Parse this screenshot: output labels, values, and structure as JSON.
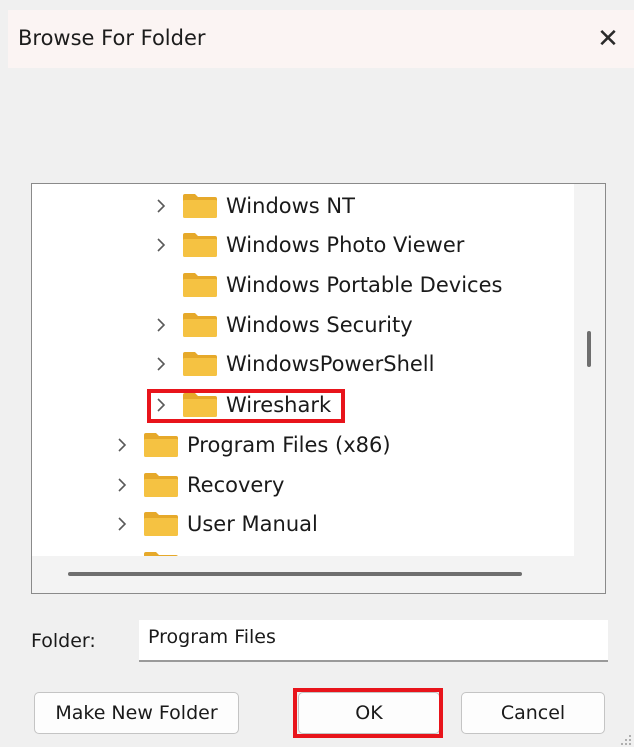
{
  "window": {
    "title": "Browse For Folder",
    "close_glyph": "✕"
  },
  "tree": {
    "items": [
      {
        "label": "Windows NT",
        "expandable": true
      },
      {
        "label": "Windows Photo Viewer",
        "expandable": true
      },
      {
        "label": "Windows Portable Devices",
        "expandable": false
      },
      {
        "label": "Windows Security",
        "expandable": true
      },
      {
        "label": "WindowsPowerShell",
        "expandable": true
      },
      {
        "label": "Wireshark",
        "expandable": true,
        "highlighted": true
      },
      {
        "label": "Program Files (x86)",
        "expandable": true
      },
      {
        "label": "Recovery",
        "expandable": true
      },
      {
        "label": "User Manual",
        "expandable": true
      }
    ]
  },
  "folder": {
    "label": "Folder:",
    "value": "Program Files"
  },
  "buttons": {
    "make_new_folder": "Make New Folder",
    "ok": "OK",
    "cancel": "Cancel"
  },
  "colors": {
    "highlight": "#e8141b",
    "folder_yellow": "#f5c242",
    "folder_back": "#e6a92a"
  },
  "icons": {
    "expand": "chevron-right-icon",
    "folder": "folder-icon",
    "close": "close-icon"
  }
}
